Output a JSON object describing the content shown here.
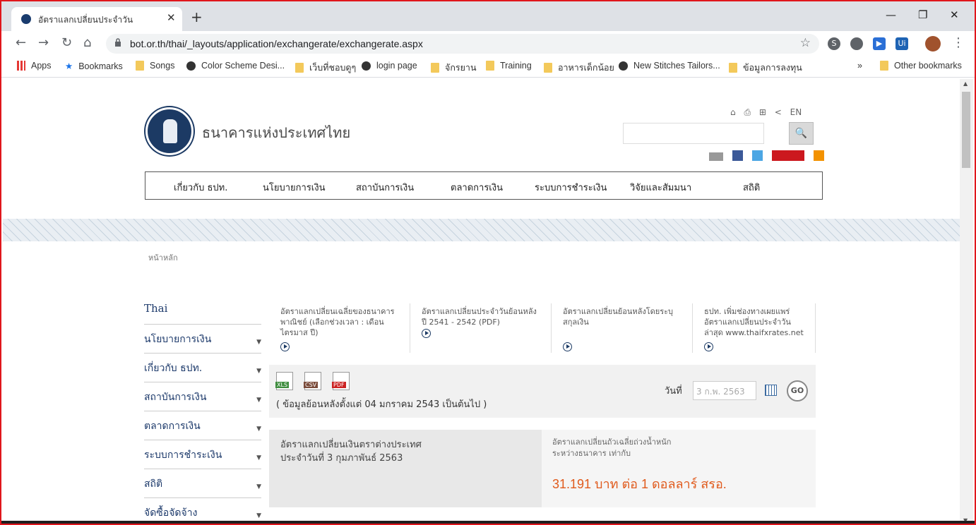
{
  "browser": {
    "tab_title": "อัตราแลกเปลี่ยนประจำวัน",
    "tab_close": "✕",
    "new_tab": "+",
    "window_controls": [
      "—",
      "❐",
      "✕"
    ],
    "url": "bot.or.th/thai/_layouts/application/exchangerate/exchangerate.aspx",
    "bookmarks": [
      "Apps",
      "Bookmarks",
      "Songs",
      "Color Scheme Desi...",
      "เว็บที่ชอบดูๆ",
      "login page",
      "จักรยาน",
      "Training",
      "อาหารเด็กน้อย",
      "New Stitches Tailors...",
      "ข้อมูลการลงทุน"
    ],
    "bookmarks_more": "»",
    "other_bookmarks": "Other bookmarks"
  },
  "header": {
    "bank_name": "ธนาคารแห่งประเทศไทย",
    "lang": "EN",
    "search_button": "🔍"
  },
  "nav": {
    "items": [
      "เกี่ยวกับ ธปท.",
      "นโยบายการเงิน",
      "สถาบันการเงิน",
      "ตลาดการเงิน",
      "ระบบการชำระเงิน",
      "วิจัยและสัมมนา",
      "สถิติ"
    ]
  },
  "breadcrumb": "หน้าหลัก",
  "sidebar": {
    "head": "Thai",
    "items": [
      "นโยบายการเงิน",
      "เกี่ยวกับ ธปท.",
      "สถาบันการเงิน",
      "ตลาดการเงิน",
      "ระบบการชำระเงิน",
      "สถิติ",
      "จัดซื้อจัดจ้าง"
    ]
  },
  "links": [
    "อัตราแลกเปลี่ยนเฉลี่ยของธนาคารพาณิชย์ (เลือกช่วงเวลา : เดือน ไตรมาส ปี)",
    "อัตราแลกเปลี่ยนประจำวันย้อนหลัง ปี 2541 - 2542 (PDF)",
    "อัตราแลกเปลี่ยนย้อนหลังโดยระบุสกุลเงิน",
    "ธปท. เพิ่มช่องทางเผยแพร่อัตราแลกเปลี่ยนประจำวันล่าสุด www.thaifxrates.net"
  ],
  "download": {
    "xls": "XLS",
    "csv": "CSV",
    "pdf": "PDF",
    "note": "( ข้อมูลย้อนหลังตั้งแต่ 04 มกราคม 2543 เป็นต้นไป )",
    "date_label": "วันที่",
    "date_placeholder": "3 ก.พ. 2563",
    "go": "GO"
  },
  "rate": {
    "left_line1": "อัตราแลกเปลี่ยนเงินตราต่างประเทศ",
    "left_line2": "ประจำวันที่ 3 กุมภาพันธ์ 2563",
    "caption_line1": "อัตราแลกเปลี่ยนถัวเฉลี่ยถ่วงน้ำหนัก",
    "caption_line2": "ระหว่างธนาคาร เท่ากับ",
    "value": "31.191 บาท ต่อ 1 ดอลลาร์ สรอ."
  },
  "colors": {
    "accent": "#1c3a64",
    "rate": "#e05a1c",
    "border": "#e0161c"
  }
}
